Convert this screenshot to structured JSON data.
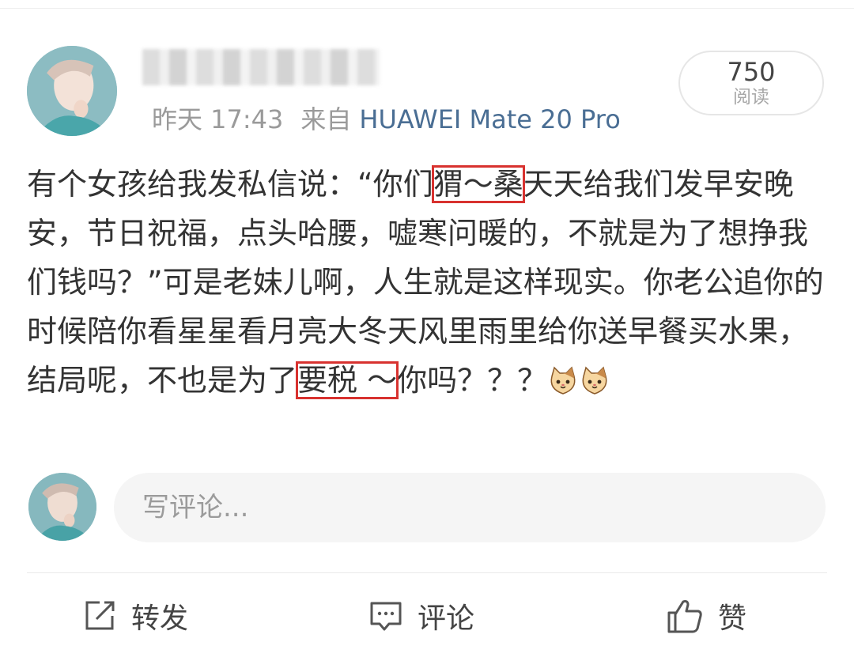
{
  "header": {
    "time": "昨天 17:43",
    "source_prefix": "来自",
    "device": "HUAWEI Mate 20 Pro",
    "read_count": "750",
    "read_label": "阅读"
  },
  "post": {
    "p1": "有个女孩给我发私信说：“你们",
    "boxed1": "猬～桑",
    "p2": "天天给我们发早安晚安，节日祝福，点头哈腰，嘘寒问暖的，不就是为了想挣我们钱吗？”可是老妹儿啊，人生就是这样现实。你老公追你的时候陪你看星星看月亮大冬天风里雨里给你送早餐买水果，结局呢，不也是为了",
    "boxed2": "要税 ～",
    "p3": "你吗？？？",
    "emoji": [
      "cat-emoji",
      "cat-emoji"
    ]
  },
  "comment_input": {
    "placeholder": "写评论..."
  },
  "actions": {
    "repost": "转发",
    "comment": "评论",
    "like": "赞"
  },
  "colors": {
    "device_link": "#4a6e94",
    "annotation_box": "#d8322f",
    "meta_gray": "#9a9a9a"
  }
}
